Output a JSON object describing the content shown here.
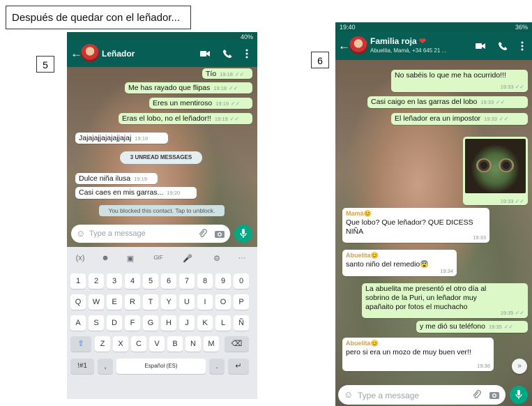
{
  "caption": "Después de quedar con el leñador...",
  "screen5": {
    "number": "5",
    "status_right": "40%",
    "contact_name": "Leñador",
    "messages_top": [
      {
        "text": "Tío",
        "time": "19:18",
        "dir": "out"
      },
      {
        "text": "Me has rayado que flipas",
        "time": "19:18",
        "dir": "out"
      },
      {
        "text": "Eres un mentiroso",
        "time": "19:19",
        "dir": "out"
      },
      {
        "text": "Eras el lobo, no el leñador!!",
        "time": "19:19",
        "dir": "out"
      },
      {
        "text": "Jajajajjajajajjajaj",
        "time": "19:19",
        "dir": "in"
      }
    ],
    "unread_label": "3 UNREAD MESSAGES",
    "messages_bottom": [
      {
        "text": "Dulce niña ilusa",
        "time": "19:19",
        "dir": "in"
      },
      {
        "text": "Casi caes en mis garras...",
        "time": "19:20",
        "dir": "in"
      }
    ],
    "blocked_notice": "You blocked this contact. Tap to unblock.",
    "input_placeholder": "Type a message",
    "suggestions": [
      "(x)",
      "☻",
      "▣",
      "GIF",
      "🎤",
      "⚙",
      "···"
    ],
    "keyboard_rows": [
      [
        "1",
        "2",
        "3",
        "4",
        "5",
        "6",
        "7",
        "8",
        "9",
        "0"
      ],
      [
        "Q",
        "W",
        "E",
        "R",
        "T",
        "Y",
        "U",
        "I",
        "O",
        "P"
      ],
      [
        "A",
        "S",
        "D",
        "F",
        "G",
        "H",
        "J",
        "K",
        "L",
        "Ñ"
      ],
      [
        "⇧",
        "Z",
        "X",
        "C",
        "V",
        "B",
        "N",
        "M",
        "⌫"
      ]
    ],
    "keyboard_bottom": {
      "symbols": "!#1",
      "comma": ",",
      "space": "Español (ES)",
      "period": ".",
      "enter": "↵"
    }
  },
  "screen6": {
    "number": "6",
    "status_time": "19:40",
    "status_right": "36%",
    "group_name": "Familia roja",
    "members": "Abuelita, Mamá, +34 645 21 ...",
    "messages": [
      {
        "text": "No sabéis lo que me ha ocurrido!!!",
        "time": "19:33",
        "dir": "out"
      },
      {
        "text": "Casi caigo en las garras del lobo",
        "time": "19:33",
        "dir": "out"
      },
      {
        "text": "El leñador era un impostor",
        "time": "19:33",
        "dir": "out"
      },
      {
        "text": "",
        "time": "19:33",
        "dir": "out",
        "kind": "image"
      },
      {
        "sender": "Mamá",
        "text": "Que lobo? Que leñador? QUE DICESS NIÑA",
        "time": "19:33",
        "dir": "in"
      },
      {
        "sender": "Abuelita",
        "text": "santo niño del remedio😨",
        "time": "19:34",
        "dir": "in"
      },
      {
        "text": "La abuelita me presentó el otro día al sobrino de la Puri, un leñador muy apañaito por fotos el muchacho",
        "time": "19:35",
        "dir": "out"
      },
      {
        "text": "y me dió su teléfono",
        "time": "19:35",
        "dir": "out"
      },
      {
        "sender": "Abuelita",
        "text": "pero si era un mozo de muy buen ver!!",
        "time": "19:36",
        "dir": "in"
      }
    ],
    "input_placeholder": "Type a message",
    "colors": {
      "mama": "#d1a34a",
      "abuelita": "#c9a05a"
    }
  },
  "colors": {
    "appbar": "#075e54",
    "outgoing": "#dcf8c6",
    "incoming": "#ffffff",
    "accent": "#00a884"
  }
}
